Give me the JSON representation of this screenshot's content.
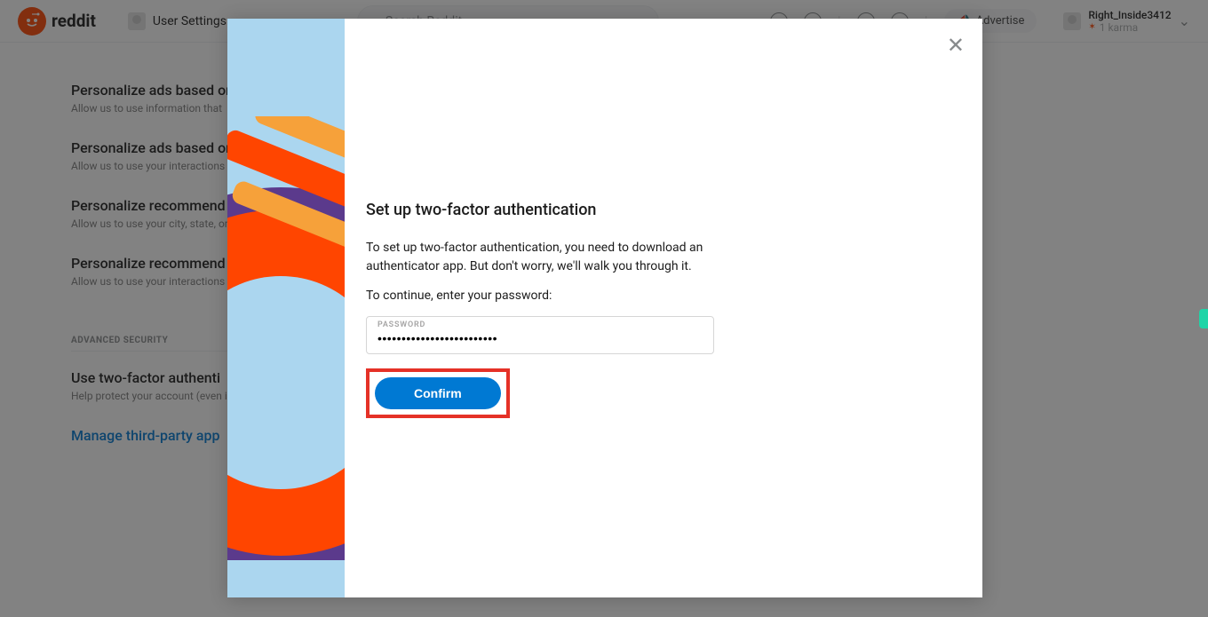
{
  "header": {
    "brand": "reddit",
    "nav_label": "User Settings",
    "search_placeholder": "Search Reddit",
    "advertise_label": "Advertise",
    "username": "Right_Inside3412",
    "karma_text": "1 karma"
  },
  "settings": {
    "items": [
      {
        "title": "Personalize ads based on",
        "desc": "Allow us to use information that"
      },
      {
        "title": "Personalize ads based on",
        "desc": "Allow us to use your interactions"
      },
      {
        "title": "Personalize recommend",
        "desc": "Allow us to use your city, state, or country to recommend communities."
      },
      {
        "title": "Personalize recommend",
        "desc": "Allow us to use your interactions with communities."
      }
    ],
    "advanced_label": "ADVANCED SECURITY",
    "twofa": {
      "title": "Use two-factor authenti",
      "desc": "Help protect your account (even if your password is compromised) by requiring a password to log in."
    },
    "thirdparty_link": "Manage third-party app"
  },
  "modal": {
    "title": "Set up two-factor authentication",
    "desc": "To set up two-factor authentication, you need to download an authenticator app. But don't worry, we'll walk you through it.",
    "prompt": "To continue, enter your password:",
    "password_label": "PASSWORD",
    "password_value": "•••••••••••••••••••••••••",
    "confirm_label": "Confirm"
  }
}
